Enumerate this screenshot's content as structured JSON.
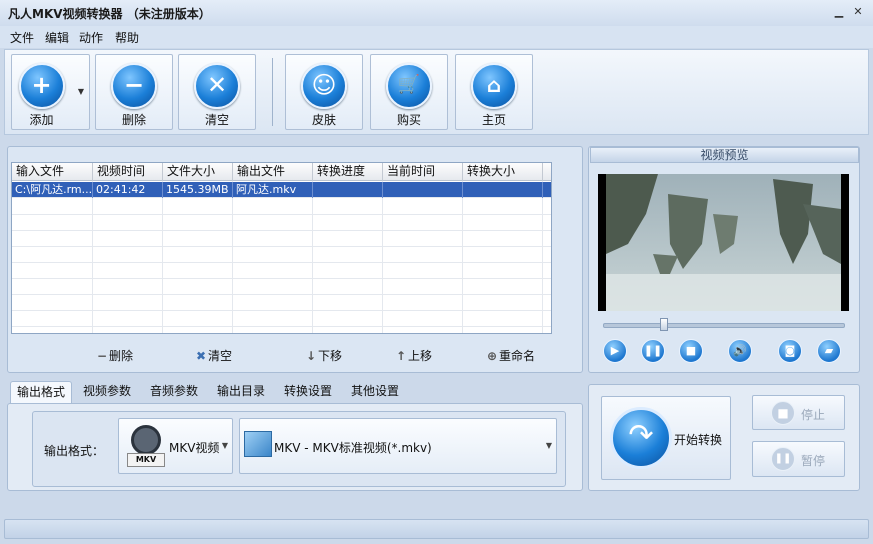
{
  "window": {
    "title": "凡人MKV视频转换器 （未注册版本）"
  },
  "menu": [
    "文件",
    "编辑",
    "动作",
    "帮助"
  ],
  "toolbar": {
    "add": "添加",
    "delete": "删除",
    "clear": "清空",
    "skin": "皮肤",
    "buy": "购买",
    "home": "主页"
  },
  "table": {
    "columns": [
      "输入文件",
      "视频时间",
      "文件大小",
      "输出文件",
      "转换进度",
      "当前时间",
      "转换大小"
    ],
    "rows": [
      [
        "C:\\阿凡达.rm...",
        "02:41:42",
        "1545.39MB",
        "阿凡达.mkv",
        "",
        "",
        ""
      ]
    ]
  },
  "list_actions": {
    "delete": "删除",
    "clear": "清空",
    "down": "下移",
    "up": "上移",
    "rename": "重命名"
  },
  "preview": {
    "title": "视频预览",
    "seek_fraction": 0.25
  },
  "tabs": [
    "输出格式",
    "视频参数",
    "音频参数",
    "输出目录",
    "转换设置",
    "其他设置"
  ],
  "output": {
    "label": "输出格式：",
    "format_icon_text": "MKV",
    "format": "MKV视频",
    "preset": "MKV - MKV标准视频(*.mkv)"
  },
  "actions": {
    "start": "开始转换",
    "stop": "停止",
    "pause": "暂停"
  },
  "colors": {
    "accent": "#1b7fd8",
    "selection": "#3060b8"
  }
}
